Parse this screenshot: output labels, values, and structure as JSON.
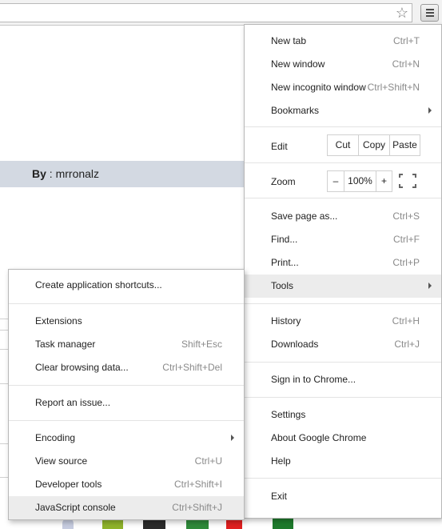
{
  "page": {
    "by_label": "By",
    "by_sep": " : ",
    "author": "mrronalz"
  },
  "icons": {
    "star": "star-icon",
    "menu": "hamburger-menu-icon",
    "submenu_arrow": "chevron-right-icon",
    "fullscreen": "fullscreen-icon"
  },
  "main_menu": {
    "new_tab": {
      "label": "New tab",
      "shortcut": "Ctrl+T"
    },
    "new_window": {
      "label": "New window",
      "shortcut": "Ctrl+N"
    },
    "new_incognito": {
      "label": "New incognito window",
      "shortcut": "Ctrl+Shift+N"
    },
    "bookmarks": {
      "label": "Bookmarks"
    },
    "edit": {
      "label": "Edit",
      "cut": "Cut",
      "copy": "Copy",
      "paste": "Paste"
    },
    "zoom": {
      "label": "Zoom",
      "minus": "–",
      "value": "100%",
      "plus": "+"
    },
    "save_page": {
      "label": "Save page as...",
      "shortcut": "Ctrl+S"
    },
    "find": {
      "label": "Find...",
      "shortcut": "Ctrl+F"
    },
    "print": {
      "label": "Print...",
      "shortcut": "Ctrl+P"
    },
    "tools": {
      "label": "Tools"
    },
    "history": {
      "label": "History",
      "shortcut": "Ctrl+H"
    },
    "downloads": {
      "label": "Downloads",
      "shortcut": "Ctrl+J"
    },
    "sign_in": {
      "label": "Sign in to Chrome..."
    },
    "settings": {
      "label": "Settings"
    },
    "about": {
      "label": "About Google Chrome"
    },
    "help": {
      "label": "Help"
    },
    "exit": {
      "label": "Exit"
    }
  },
  "tools_menu": {
    "create_shortcuts": {
      "label": "Create application shortcuts..."
    },
    "extensions": {
      "label": "Extensions"
    },
    "task_manager": {
      "label": "Task manager",
      "shortcut": "Shift+Esc"
    },
    "clear_data": {
      "label": "Clear browsing data...",
      "shortcut": "Ctrl+Shift+Del"
    },
    "report_issue": {
      "label": "Report an issue..."
    },
    "encoding": {
      "label": "Encoding"
    },
    "view_source": {
      "label": "View source",
      "shortcut": "Ctrl+U"
    },
    "developer_tools": {
      "label": "Developer tools",
      "shortcut": "Ctrl+Shift+I"
    },
    "js_console": {
      "label": "JavaScript console",
      "shortcut": "Ctrl+Shift+J"
    }
  },
  "colors": {
    "highlight": "#ececec",
    "band": "#d3d9e2",
    "shortcut": "#8a8a8a"
  }
}
